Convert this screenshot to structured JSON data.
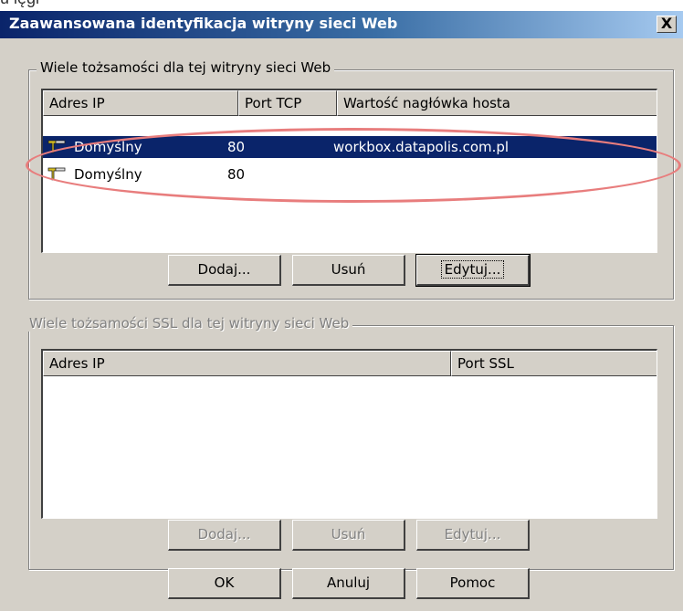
{
  "background": {
    "partial_text": "u ięgi"
  },
  "titlebar": {
    "title": "Zaawansowana identyfikacja witryny sieci Web",
    "close_label": "X"
  },
  "web_group": {
    "legend": "Wiele tożsamości dla tej witryny sieci Web",
    "columns": [
      "Adres IP",
      "Port TCP",
      "Wartość nagłówka hosta"
    ],
    "rows": [
      {
        "ip": "Domyślny",
        "port": "80",
        "host": "workbox.datapolis.com.pl",
        "selected": true
      },
      {
        "ip": "Domyślny",
        "port": "80",
        "host": "",
        "selected": false
      }
    ],
    "buttons": {
      "add": "Dodaj...",
      "remove": "Usuń",
      "edit": "Edytuj..."
    }
  },
  "ssl_group": {
    "legend": "Wiele tożsamości SSL dla tej witryny sieci Web",
    "columns": [
      "Adres IP",
      "Port SSL"
    ],
    "buttons": {
      "add": "Dodaj...",
      "remove": "Usuń",
      "edit": "Edytuj..."
    }
  },
  "footer": {
    "ok": "OK",
    "cancel": "Anuluj",
    "help": "Pomoc"
  },
  "colors": {
    "selection": "#0a246a",
    "annotation": "#e87d7d",
    "dialog_face": "#d4d0c8"
  },
  "icons": {
    "row_icon": "network-connector-icon"
  }
}
